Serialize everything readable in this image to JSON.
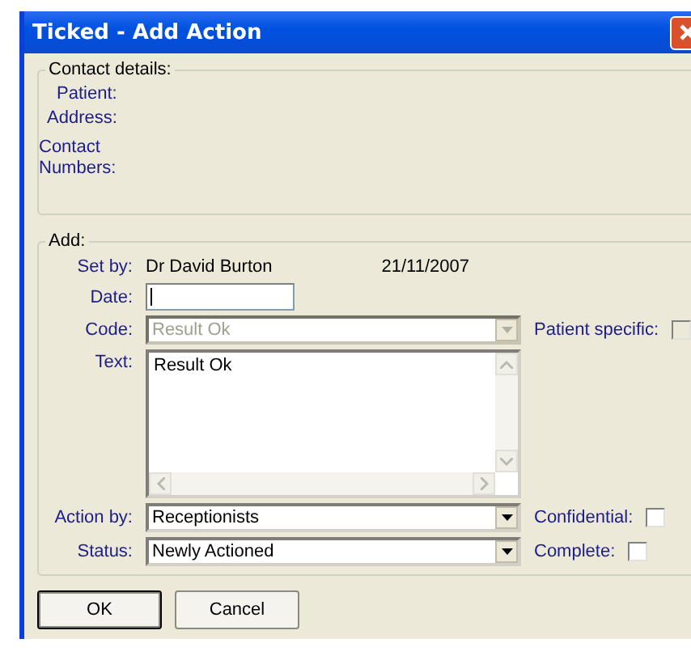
{
  "window": {
    "title": "Ticked - Add Action"
  },
  "contact_details": {
    "legend": "Contact details:",
    "labels": [
      "Patient:",
      "Address:",
      "Contact Numbers:"
    ]
  },
  "add": {
    "legend": "Add:",
    "set_by": {
      "label": "Set by:",
      "name": "Dr David Burton",
      "date": "21/11/2007"
    },
    "date": {
      "label": "Date:"
    },
    "code": {
      "label": "Code:",
      "value": "Result Ok",
      "disabled": true
    },
    "patient_specific": {
      "label": "Patient specific:",
      "checked": false,
      "disabled": true
    },
    "text": {
      "label": "Text:",
      "value": "Result Ok"
    },
    "action_by": {
      "label": "Action by:",
      "value": "Receptionists",
      "disabled": false
    },
    "confidential": {
      "label": "Confidential:",
      "checked": false,
      "disabled": false
    },
    "status": {
      "label": "Status:",
      "value": "Newly Actioned",
      "disabled": false
    },
    "complete": {
      "label": "Complete:",
      "checked": false,
      "disabled": false
    }
  },
  "buttons": [
    {
      "label": "OK",
      "default": true
    },
    {
      "label": "Cancel",
      "default": false
    }
  ]
}
